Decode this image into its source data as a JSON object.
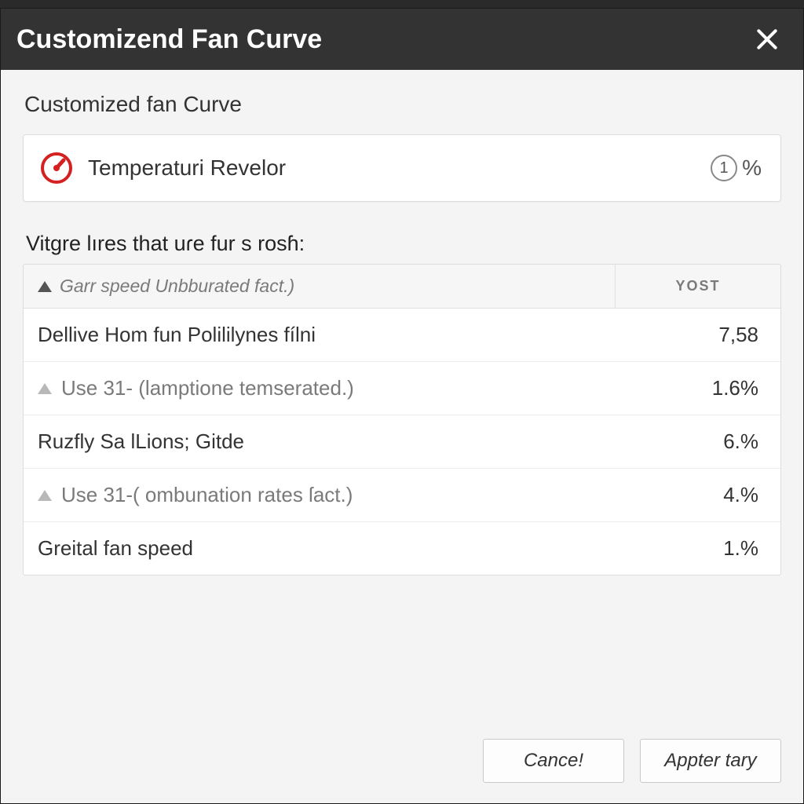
{
  "titlebar": {
    "title": "Customizend Fan Curve"
  },
  "subtitle": "Customized fan Curve",
  "sensor_card": {
    "icon": "gauge-icon",
    "label": "Temperaturi Revelor",
    "value_badge": "1",
    "value_unit": "%"
  },
  "section_label": "Vitgre lıres that uɾe fur s rosɦ:",
  "table": {
    "header": {
      "main": "Garr speed Unbburated fact.)",
      "value": "YOST"
    },
    "rows": [
      {
        "marker": "none",
        "label": "Dellive Hom fun Polililynes fílni",
        "value": "7,58",
        "muted": false
      },
      {
        "marker": "light",
        "label": "Use 31- (lamptione temserated.)",
        "value": "1.6%",
        "muted": true
      },
      {
        "marker": "none",
        "label": "Ruzfly Sa lLions; Gitde",
        "value": "6.%",
        "muted": false
      },
      {
        "marker": "light",
        "label": "Use 31-( ombunation rates ſact.)",
        "value": "4.%",
        "muted": true
      },
      {
        "marker": "none",
        "label": "Greital fan speed",
        "value": "1.%",
        "muted": false
      }
    ]
  },
  "footer": {
    "cancel": "Cance!",
    "apply": "Appter tary"
  }
}
